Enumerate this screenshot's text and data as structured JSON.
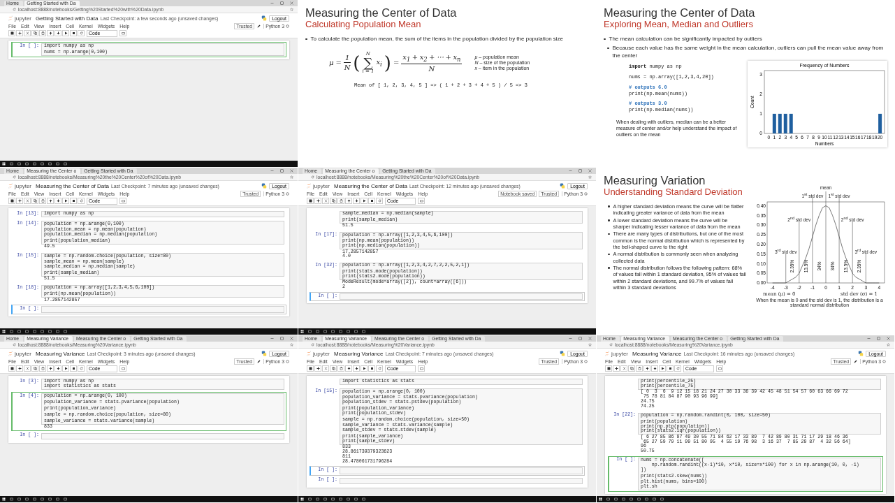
{
  "tiles": [
    {
      "kind": "notebook",
      "tabs": [
        {
          "label": "Home",
          "selected": false
        },
        {
          "label": "Getting Started with Da",
          "selected": true
        }
      ],
      "url": "localhost:8888/notebooks/Getting%20Started%20with%20Data.ipynb",
      "logo": "jupyter",
      "title": "Getting Started with Data",
      "checkpoint": "Last Checkpoint: a few seconds ago (unsaved changes)",
      "logout": "Logout",
      "menu": [
        "File",
        "Edit",
        "View",
        "Insert",
        "Cell",
        "Kernel",
        "Widgets",
        "Help"
      ],
      "indicators": [
        "Trusted"
      ],
      "pencil": true,
      "kernel": "Python 3",
      "cell_type": "Code",
      "cells": [
        {
          "prompt": "In [ ]:",
          "selected": true,
          "edit_mode": true,
          "blocks": [
            [
              "import numpy as np"
            ],
            [
              "nums = np.arange(0,100)"
            ]
          ]
        }
      ]
    },
    {
      "kind": "formula-slide",
      "title": "Measuring the Center of Data",
      "subtitle": "Calculating Population Mean",
      "bullets": [
        {
          "text": "To calculate the population mean, the sum of the items in the population divided by the population size"
        }
      ],
      "formula": [
        {
          "kind": "sym",
          "text": "μ"
        },
        {
          "kind": "op",
          "text": "="
        },
        {
          "kind": "frac",
          "num": [
            "1"
          ],
          "den": "N"
        },
        {
          "kind": "paren",
          "text": "("
        },
        {
          "kind": "sum",
          "upper": "N",
          "sign": "∑",
          "lower": "i = 1"
        },
        {
          "kind": "sym",
          "text": "x$_{i}$"
        },
        {
          "kind": "paren",
          "text": ")"
        },
        {
          "kind": "op",
          "text": "="
        },
        {
          "kind": "frac",
          "num": [
            "x$_{1}$",
            "+",
            "x$_{2}$",
            "+",
            "⋯",
            "+",
            "x$_{n}$"
          ],
          "den": "N"
        }
      ],
      "legend": [
        "*μ* – population mean",
        "*N* – size of the population",
        "*x* – item in the population"
      ],
      "example": "Mean of [ 1, 2, 3, 4, 5 ] => ( 1 + 2 + 3 + 4 + 5 ) / 5 => 3"
    },
    {
      "kind": "code-chart-slide",
      "title": "Measuring the Center of Data",
      "subtitle": "Exploring Mean, Median and Outliers",
      "bullets": [
        {
          "text": "The mean calculation can be significantly impacted by outliers",
          "children": [
            {
              "text": "Because each value has the same weight in the mean calculation, outliers can pull the mean value away from the center"
            }
          ]
        }
      ],
      "code": [
        [
          {
            "kind": "code",
            "text": "**import** numpy as np"
          }
        ],
        [
          {
            "kind": "code",
            "text": "nums = np.array([1,2,3,4,20])"
          }
        ],
        [
          {
            "kind": "comment",
            "text": "# outputs 6.0"
          },
          {
            "kind": "code",
            "text": "print(np.mean(nums))"
          }
        ],
        [
          {
            "kind": "comment",
            "text": "# outputs 3.0"
          },
          {
            "kind": "code",
            "text": "print(np.median(nums))"
          }
        ]
      ],
      "caption": "When dealing with outliers, median can be a better measure of center and/or help understand the impact of outliers on the mean",
      "chart_data": {
        "type": "bar",
        "title": "Frequency of Numbers",
        "xlabel": "Numbers",
        "ylabel": "Count",
        "x": [
          0,
          1,
          2,
          3,
          4,
          5,
          6,
          7,
          8,
          9,
          10,
          11,
          12,
          13,
          14,
          15,
          16,
          17,
          18,
          19,
          20
        ],
        "series": [
          {
            "color": "#1f5f9f",
            "values": [
              0,
              1,
              1,
              1,
              1,
              0,
              0,
              0,
              0,
              0,
              0,
              0,
              0,
              0,
              0,
              0,
              0,
              0,
              0,
              0,
              1
            ]
          }
        ],
        "xlim": [
          -0.8,
          20.8
        ],
        "ylim": [
          0,
          3.2
        ],
        "xticks": [
          0,
          1,
          2,
          3,
          4,
          5,
          6,
          7,
          8,
          9,
          10,
          11,
          12,
          13,
          14,
          15,
          16,
          17,
          18,
          19,
          20
        ],
        "yticks": [
          0,
          1,
          2,
          3
        ]
      }
    },
    {
      "kind": "notebook",
      "tabs": [
        {
          "label": "Home",
          "selected": false
        },
        {
          "label": "Measuring the Center o",
          "selected": true
        },
        {
          "label": "Getting Started with Da",
          "selected": false
        }
      ],
      "url": "localhost:8888/notebooks/Measuring%20the%20Center%20of%20Data.ipynb",
      "logo": "jupyter",
      "title": "Measuring the Center of Data",
      "checkpoint": "Last Checkpoint: 7 minutes ago (unsaved changes)",
      "logout": "Logout",
      "menu": [
        "File",
        "Edit",
        "View",
        "Insert",
        "Cell",
        "Kernel",
        "Widgets",
        "Help"
      ],
      "indicators": [
        "Trusted"
      ],
      "pencil": false,
      "kernel": "Python 3",
      "cell_type": "Code",
      "cells": [
        {
          "prompt": "In [13]:",
          "selected": false,
          "blocks": [
            [
              "import numpy as np"
            ]
          ]
        },
        {
          "prompt": "In [14]:",
          "selected": false,
          "blocks": [
            [
              "population = np.arange(0,100)"
            ],
            [
              "population_mean = np.mean(population)",
              "population_median = np.median(population)"
            ],
            [
              "print(population_median)"
            ]
          ],
          "output": [
            "49.5"
          ]
        },
        {
          "prompt": "In [15]:",
          "selected": false,
          "blocks": [
            [
              "sample = np.random.choice(population, size=80)"
            ],
            [
              "sample_mean = np.mean(sample)",
              "sample_median = np.median(sample)"
            ],
            [
              "print(sample_median)"
            ]
          ],
          "output": [
            "51.5"
          ]
        },
        {
          "prompt": "In [18]:",
          "selected": false,
          "blocks": [
            [
              "population = np.array([1,2,3,4,5,6,100])"
            ],
            [
              "print(np.mean(population))"
            ]
          ],
          "output": [
            "17.2857142857"
          ]
        },
        {
          "prompt": "In [ ]:",
          "selected": true,
          "edit_mode": false
        }
      ]
    },
    {
      "kind": "notebook",
      "tabs": [
        {
          "label": "Home",
          "selected": false
        },
        {
          "label": "Measuring the Center o",
          "selected": true
        },
        {
          "label": "Getting Started with Da",
          "selected": false
        }
      ],
      "url": "localhost:8888/notebooks/Measuring%20the%20Center%20of%20Data.ipynb",
      "logo": "jupyter",
      "title": "Measuring the Center of Data",
      "checkpoint": "Last Checkpoint: 12 minutes ago (unsaved changes)",
      "logout": "Logout",
      "menu": [
        "File",
        "Edit",
        "View",
        "Insert",
        "Cell",
        "Kernel",
        "Widgets",
        "Help"
      ],
      "indicators": [
        "Notebook saved",
        "Trusted"
      ],
      "pencil": false,
      "kernel": "Python 3",
      "cell_type": "Code",
      "cells": [
        {
          "selected": false,
          "blocks": [
            [
              "sample_median = np.median(sample)"
            ],
            [
              "print(sample_median)"
            ]
          ],
          "output": [
            "51.5"
          ]
        },
        {
          "prompt": "In [17]:",
          "selected": false,
          "blocks": [
            [
              "population = np.array([1,2,3,4,5,6,100])"
            ],
            [
              "print(np.mean(population))",
              "print(np.median(population))"
            ]
          ],
          "output": [
            "17.2857142857",
            "4.0"
          ]
        },
        {
          "prompt": "In [32]:",
          "selected": false,
          "blocks": [
            [
              "population = np.array([1,2,3,4,2,7,2,2,5,2,1])"
            ],
            [
              "print(stats.mode(population))",
              "print(stats2.mode(population))"
            ]
          ],
          "output": [
            "ModeResult(mode=array([2]), count=array([6]))",
            "2"
          ]
        },
        {
          "prompt": "In [ ]:",
          "selected": true,
          "edit_mode": false
        }
      ]
    },
    {
      "kind": "chart-slide",
      "title": "Measuring Variation",
      "subtitle": "Understanding Standard Deviation",
      "bullets": [
        {
          "text": "A higher standard deviation means the curve will be flatter indicating greater variance of data from the mean"
        },
        {
          "text": "A lower standard deviation means the curve will be sharper indicating lesser variance of data from the mean"
        },
        {
          "text": "There are many types of distributions, but one of the most common is the normal distribution which is represented by the bell-shaped curve to the right"
        },
        {
          "text": "A normal distribution is commonly seen when analyzing collected data"
        },
        {
          "text": "The normal distribution follows the following pattern: 68% of values fall within 1 standard deviation, 95% of values fall within 2 standard deviations, and 99.7% of values fall within 3 standard deviations"
        }
      ],
      "chart_data": {
        "type": "line",
        "x": [
          -4,
          -3.75,
          -3.5,
          -3.25,
          -3,
          -2.75,
          -2.5,
          -2.25,
          -2,
          -1.75,
          -1.5,
          -1.25,
          -1,
          -0.75,
          -0.5,
          -0.25,
          0,
          0.25,
          0.5,
          0.75,
          1,
          1.25,
          1.5,
          1.75,
          2,
          2.25,
          2.5,
          2.75,
          3,
          3.25,
          3.5,
          3.75,
          4
        ],
        "series": [
          {
            "color": "#555555",
            "values": [
              0,
              0,
              0,
              0,
              0,
              0.01,
              0.02,
              0.03,
              0.05,
              0.09,
              0.13,
              0.18,
              0.24,
              0.3,
              0.35,
              0.39,
              0.4,
              0.39,
              0.35,
              0.3,
              0.24,
              0.18,
              0.13,
              0.09,
              0.05,
              0.03,
              0.02,
              0.01,
              0,
              0,
              0,
              0,
              0
            ]
          }
        ],
        "xlim": [
          -4.4,
          4.4
        ],
        "ylim": [
          0,
          0.42
        ],
        "xticks": [
          -4,
          -3,
          -2,
          -1,
          0,
          1,
          2,
          3,
          4
        ],
        "yticks": [
          {
            "value": 0,
            "label": "0.00"
          },
          {
            "value": 0.05,
            "label": "0.05"
          },
          {
            "value": 0.1,
            "label": "0.10"
          },
          {
            "value": 0.15,
            "label": "0.15"
          },
          {
            "value": 0.2,
            "label": "0.20"
          },
          {
            "value": 0.25,
            "label": "0.25"
          },
          {
            "value": 0.3,
            "label": "0.30"
          },
          {
            "value": 0.35,
            "label": "0.35"
          },
          {
            "value": 0.4,
            "label": "0.40"
          }
        ],
        "ref_lines": [
          {
            "axis": "x",
            "value": -3,
            "label": "3$^{rd}$ std dev"
          },
          {
            "axis": "x",
            "value": -2,
            "label": "2$^{nd}$ std dev"
          },
          {
            "axis": "x",
            "value": -1,
            "label": "1$^{st}$ std dev"
          },
          {
            "axis": "x",
            "value": 0,
            "label": "mean"
          },
          {
            "axis": "x",
            "value": 1,
            "label": "1$^{st}$ std dev"
          },
          {
            "axis": "x",
            "value": 2,
            "label": "2$^{nd}$ std dev"
          },
          {
            "axis": "x",
            "value": 3,
            "label": "3$^{rd}$ std dev"
          }
        ],
        "annotations": [
          "2.35%",
          "13.5%",
          "34%",
          "34%",
          "13.5%",
          "2.35%"
        ]
      },
      "axis_notes": [
        "mean (μ) = 0",
        "std dev (σ) = 1"
      ],
      "caption": "When the mean is 0 and the std dev is 1, the distribution is a standard normal distribution"
    },
    {
      "kind": "notebook",
      "tabs": [
        {
          "label": "Home",
          "selected": false
        },
        {
          "label": "Measuring Variance",
          "selected": true
        },
        {
          "label": "Measuring the Center o",
          "selected": false
        },
        {
          "label": "Getting Started with Da",
          "selected": false
        }
      ],
      "url": "localhost:8888/notebooks/Measuring%20Variance.ipynb",
      "logo": "jupyter",
      "title": "Measuring Variance",
      "checkpoint": "Last Checkpoint: 3 minutes ago (unsaved changes)",
      "logout": "Logout",
      "menu": [
        "File",
        "Edit",
        "View",
        "Insert",
        "Cell",
        "Kernel",
        "Widgets",
        "Help"
      ],
      "indicators": [
        "Trusted"
      ],
      "pencil": true,
      "kernel": "Python 3",
      "cell_type": "Code",
      "cells": [
        {
          "prompt": "In [3]:",
          "selected": false,
          "blocks": [
            [
              "import numpy as np",
              "import statistics as stats"
            ]
          ]
        },
        {
          "prompt": "In [4]:",
          "selected": true,
          "edit_mode": true,
          "blocks": [
            [
              "population = np.arange(0, 100)"
            ],
            [
              "population_variance = stats.pvariance(population)"
            ],
            [
              "print(population_variance)"
            ],
            [
              "sample = np.random.choice(population, size=80)"
            ],
            [
              "sample_variance = stats.variance(sample)"
            ]
          ],
          "output": [
            "833"
          ]
        },
        {
          "prompt": "In [ ]:",
          "selected": false
        }
      ]
    },
    {
      "kind": "notebook",
      "tabs": [
        {
          "label": "Home",
          "selected": false
        },
        {
          "label": "Measuring Variance",
          "selected": true
        },
        {
          "label": "Measuring the Center o",
          "selected": false
        },
        {
          "label": "Getting Started with Da",
          "selected": false
        }
      ],
      "url": "localhost:8888/notebooks/Measuring%20Variance.ipynb",
      "logo": "jupyter",
      "title": "Measuring Variance",
      "checkpoint": "Last Checkpoint: 7 minutes ago (unsaved changes)",
      "logout": "Logout",
      "menu": [
        "File",
        "Edit",
        "View",
        "Insert",
        "Cell",
        "Kernel",
        "Widgets",
        "Help"
      ],
      "indicators": [
        "Trusted"
      ],
      "pencil": false,
      "kernel": "Python 3",
      "cell_type": "Code",
      "cells": [
        {
          "selected": false,
          "blocks": [
            [
              "import statistics as stats"
            ]
          ]
        },
        {
          "prompt": "In [15]:",
          "selected": false,
          "blocks": [
            [
              "population = np.arange(0, 100)"
            ],
            [
              "population_variance = stats.pvariance(population)",
              "population_stdev = stats.pstdev(population)"
            ],
            [
              "print(population_variance)",
              "print(population_stdev)"
            ],
            [
              "sample = np.random.choice(population, size=50)"
            ],
            [
              "sample_variance = stats.variance(sample)",
              "sample_stdev = stats.stdev(sample)"
            ],
            [
              "print(sample_variance)",
              "print(sample_stdev)"
            ]
          ],
          "output": [
            "833",
            "28.861739379323623",
            "811",
            "28.478061731796284"
          ]
        },
        {
          "prompt": "In [ ]:",
          "selected": true,
          "edit_mode": false
        },
        {
          "prompt": "In [ ]:",
          "selected": false
        }
      ]
    },
    {
      "kind": "notebook",
      "tabs": [
        {
          "label": "Home",
          "selected": false
        },
        {
          "label": "Measuring Variance",
          "selected": true
        },
        {
          "label": "Measuring the Center o",
          "selected": false
        },
        {
          "label": "Getting Started with Da",
          "selected": false
        }
      ],
      "url": "localhost:8888/notebooks/Measuring%20Variance.ipynb",
      "logo": "jupyter",
      "title": "Measuring Variance",
      "checkpoint": "Last Checkpoint: 16 minutes ago (unsaved changes)",
      "logout": "Logout",
      "menu": [
        "File",
        "Edit",
        "View",
        "Insert",
        "Cell",
        "Kernel",
        "Widgets",
        "Help"
      ],
      "indicators": [
        "Trusted"
      ],
      "pencil": true,
      "kernel": "Python 3",
      "cell_type": "Code",
      "cells": [
        {
          "selected": false,
          "blocks": [
            [
              "print(percentile_25)",
              "print(percentile_75)"
            ]
          ],
          "output": [
            "[ 0  3  6  9 12 15 18 21 24 27 30 33 36 39 42 45 48 51 54 57 60 63 66 69 72",
            " 75 78 81 84 87 90 93 96 99]",
            "24.75",
            "74.25"
          ]
        },
        {
          "prompt": "In [22]:",
          "selected": false,
          "blocks": [
            [
              "population = np.random.randint(0, 100, size=50)"
            ],
            [
              "print(population)",
              "print(np.ptp(population))",
              "print(stats2.iqr(population))"
            ]
          ],
          "output": [
            "[ 6 27 85 86 97 49 30 55 71 84 62 17 33 89  7 42 89 80 31 71 17 29 18 46 36",
            " 65 27 59 79 11 99 51 80 95  4 55 19 76 98  3 16 37  7 85 29 87  4 32 56 64]",
            "96",
            "50.75"
          ]
        },
        {
          "prompt": "In [ ]:",
          "selected": true,
          "edit_mode": true,
          "blocks": [
            [
              "nums = np.concatenate([",
              "    np.random.randint((x-1)*10, x*10, size=x*100) for x in np.arange(10, 0, -1)",
              "])"
            ],
            [
              "print(stats2.skew(nums))"
            ],
            [
              "plt.hist(nums, bins=100)",
              "plt.sh"
            ]
          ]
        }
      ]
    }
  ]
}
